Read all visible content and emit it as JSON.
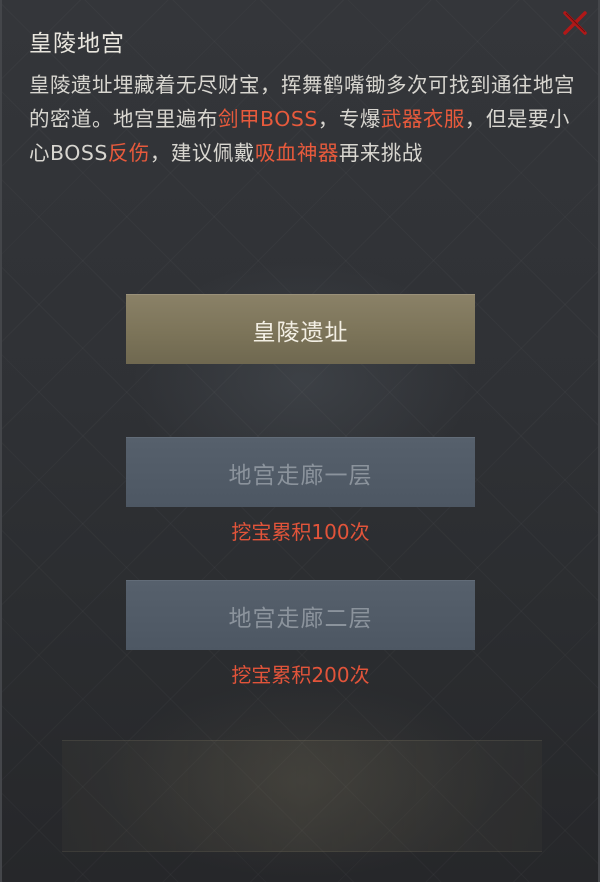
{
  "dialog": {
    "title": "皇陵地宫",
    "close_icon": "close-icon",
    "description": [
      {
        "text": "皇陵遗址埋藏着无尽财宝，挥舞鹤嘴锄多次可找到通往地宫的密道。地宫里遍布",
        "highlight": false
      },
      {
        "text": "剑甲BOSS",
        "highlight": true
      },
      {
        "text": "，专爆",
        "highlight": false
      },
      {
        "text": "武器衣服",
        "highlight": true
      },
      {
        "text": "，但是要小心BOSS",
        "highlight": false
      },
      {
        "text": "反伤",
        "highlight": true
      },
      {
        "text": "，建议佩戴",
        "highlight": false
      },
      {
        "text": "吸血神器",
        "highlight": true
      },
      {
        "text": "再来挑战",
        "highlight": false
      }
    ]
  },
  "options": [
    {
      "label": "皇陵遗址",
      "state": "available",
      "requirement": ""
    },
    {
      "label": "地宫走廊一层",
      "state": "locked",
      "requirement": "挖宝累积100次"
    },
    {
      "label": "地宫走廊二层",
      "state": "locked",
      "requirement": "挖宝累积200次"
    }
  ],
  "colors": {
    "highlight": "#e85a3c",
    "requirement": "#e2543a",
    "primary_button": "#7c7459",
    "locked_button": "#515b67",
    "close_icon": "#b01818"
  }
}
